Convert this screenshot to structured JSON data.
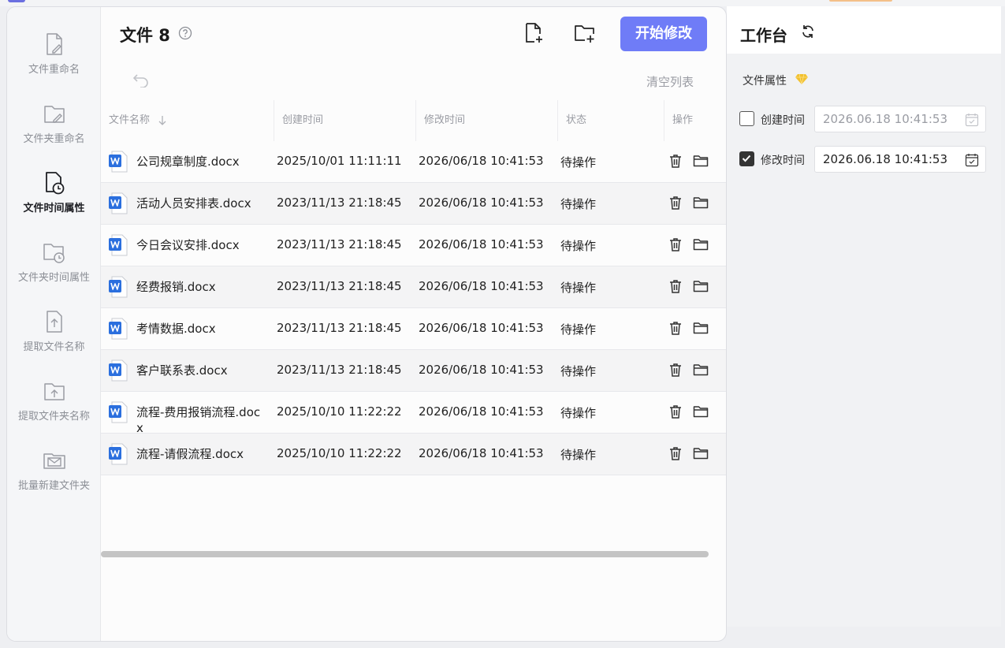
{
  "sidebar": {
    "items": [
      {
        "label": "文件重命名",
        "icon": "file-edit-icon",
        "active": false
      },
      {
        "label": "文件夹重命名",
        "icon": "folder-edit-icon",
        "active": false
      },
      {
        "label": "文件时间属性",
        "icon": "file-clock-icon",
        "active": true
      },
      {
        "label": "文件夹时间属性",
        "icon": "folder-clock-icon",
        "active": false
      },
      {
        "label": "提取文件名称",
        "icon": "file-upload-icon",
        "active": false
      },
      {
        "label": "提取文件夹名称",
        "icon": "folder-upload-icon",
        "active": false
      },
      {
        "label": "批量新建文件夹",
        "icon": "folder-mail-icon",
        "active": false
      }
    ]
  },
  "header": {
    "title": "文件 8",
    "start_button": "开始修改",
    "clear_list": "清空列表"
  },
  "table": {
    "columns": [
      "文件名称",
      "创建时间",
      "修改时间",
      "状态",
      "操作"
    ],
    "rows": [
      {
        "name": "公司规章制度.docx",
        "created": "2025/10/01 11:11:11",
        "modified": "2026/06/18 10:41:53",
        "status": "待操作"
      },
      {
        "name": "活动人员安排表.docx",
        "created": "2023/11/13 21:18:45",
        "modified": "2026/06/18 10:41:53",
        "status": "待操作"
      },
      {
        "name": "今日会议安排.docx",
        "created": "2023/11/13 21:18:45",
        "modified": "2026/06/18 10:41:53",
        "status": "待操作"
      },
      {
        "name": "经费报销.docx",
        "created": "2023/11/13 21:18:45",
        "modified": "2026/06/18 10:41:53",
        "status": "待操作"
      },
      {
        "name": "考情数据.docx",
        "created": "2023/11/13 21:18:45",
        "modified": "2026/06/18 10:41:53",
        "status": "待操作"
      },
      {
        "name": "客户联系表.docx",
        "created": "2023/11/13 21:18:45",
        "modified": "2026/06/18 10:41:53",
        "status": "待操作"
      },
      {
        "name": "流程-费用报销流程.docx",
        "created": "2025/10/10 11:22:22",
        "modified": "2026/06/18 10:41:53",
        "status": "待操作"
      },
      {
        "name": "流程-请假流程.docx",
        "created": "2025/10/10 11:22:22",
        "modified": "2026/06/18 10:41:53",
        "status": "待操作"
      }
    ]
  },
  "panel": {
    "title": "工作台",
    "section_title": "文件属性",
    "created": {
      "label": "创建时间",
      "checked": false,
      "value": "2026.06.18 10:41:53"
    },
    "modified": {
      "label": "修改时间",
      "checked": true,
      "value": "2026.06.18 10:41:53"
    }
  },
  "colors": {
    "accent": "#6f7cf7",
    "word_blue": "#2b6fde",
    "diamond": "#f2c12e"
  }
}
